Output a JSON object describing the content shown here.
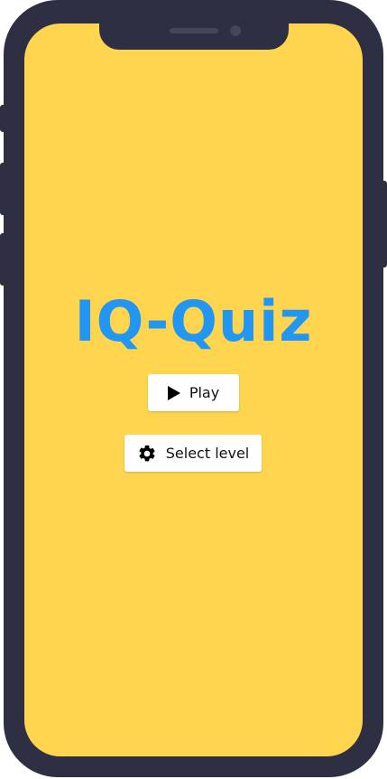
{
  "app": {
    "title": "IQ-Quiz"
  },
  "buttons": {
    "play_label": "Play",
    "play_icon": "play-icon",
    "select_level_label": "Select level",
    "select_level_icon": "gear-icon"
  },
  "colors": {
    "background": "#ffd54f",
    "title": "#2196f3",
    "button_bg": "#ffffff",
    "device_frame": "#2e2f42"
  }
}
